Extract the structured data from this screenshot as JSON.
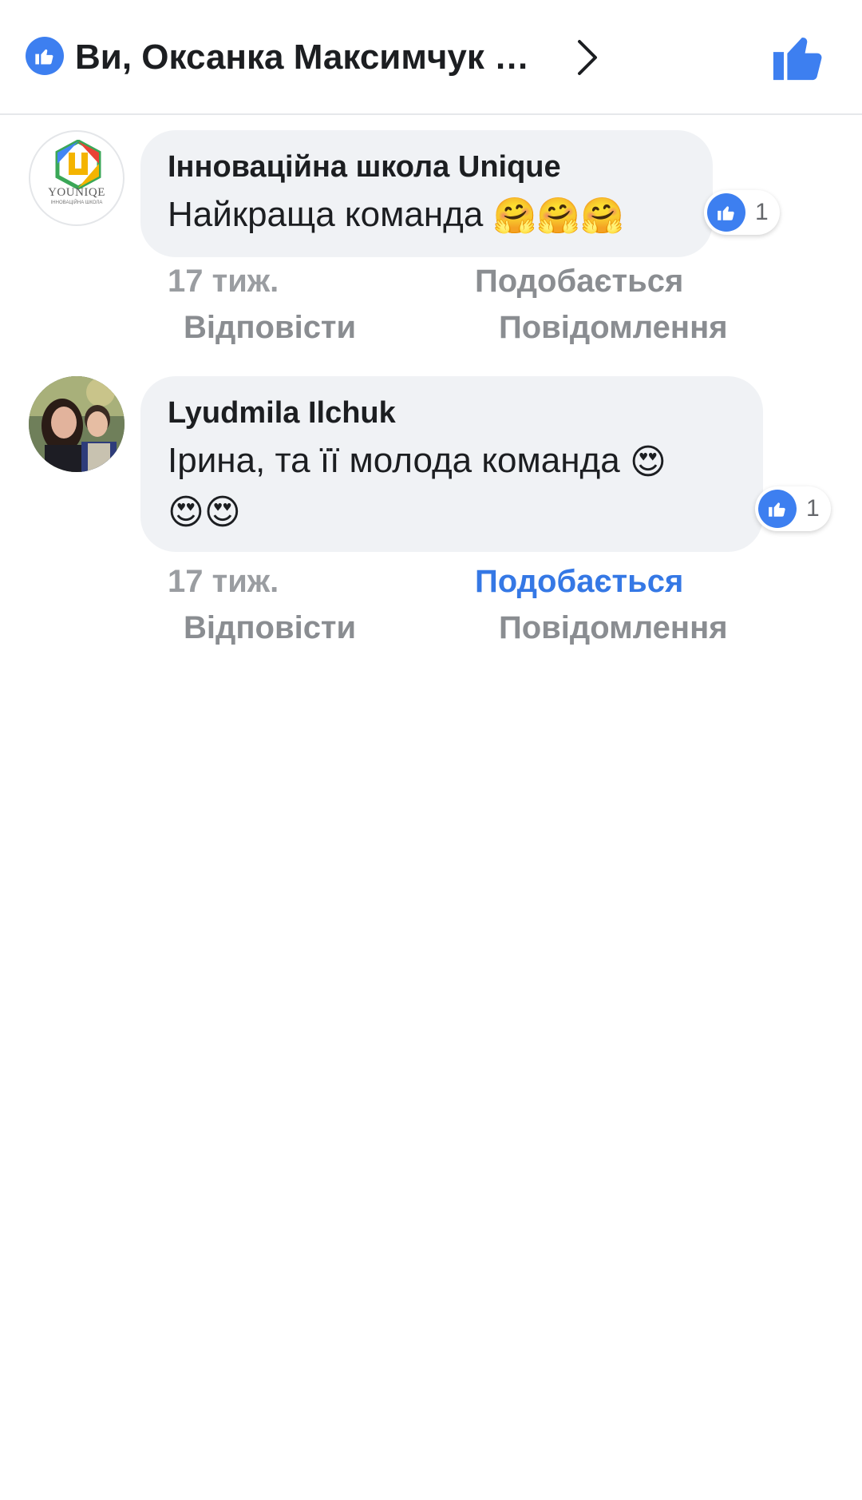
{
  "header": {
    "title": "Ви, Оксанка Максимчук …",
    "accent_color": "#3d7ff0",
    "icons": [
      "like-badge-icon",
      "chevron-right-icon",
      "thumbs-up-icon"
    ]
  },
  "comments": [
    {
      "author": "Інноваційна школа Unique",
      "avatar_logo_text": "YOUNIQE",
      "avatar_logo_sub": "ІННОВАЦІЙНА ШКОЛА",
      "text": "Найкраща команда",
      "emoji": [
        "🤗",
        "🤗",
        "🤗"
      ],
      "reaction_count": "1",
      "time": "17 тиж.",
      "like_label": "Подобається",
      "liked": false,
      "reply_label": "Відповісти",
      "message_label": "Повідомлення"
    },
    {
      "author": "Lyudmila Ilchuk",
      "text": "Ірина, та її молода команда",
      "emoji_line1": [
        "😍"
      ],
      "emoji_line2": [
        "😍",
        "😍"
      ],
      "reaction_count": "1",
      "time": "17 тиж.",
      "like_label": "Подобається",
      "liked": true,
      "reply_label": "Відповісти",
      "message_label": "Повідомлення"
    }
  ]
}
